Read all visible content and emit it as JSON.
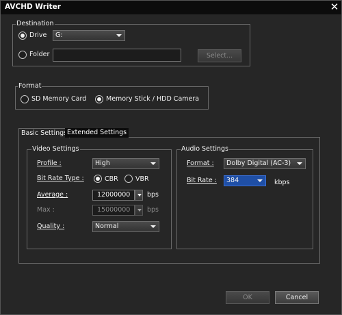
{
  "window": {
    "title": "AVCHD Writer",
    "close_glyph": "✕"
  },
  "destination": {
    "label": "Destination",
    "drive_label": "Drive",
    "drive_value": "G:",
    "folder_label": "Folder",
    "folder_value": "",
    "select_button": "Select..."
  },
  "format": {
    "label": "Format",
    "option_sd": "SD Memory Card",
    "option_ms": "Memory Stick / HDD Camera"
  },
  "tabs": {
    "basic": "Basic Settings",
    "extended": "Extended Settings"
  },
  "video": {
    "label": "Video Settings",
    "profile_label": "Profile :",
    "profile_value": "High",
    "bitrate_type_label": "Bit Rate Type :",
    "cbr": "CBR",
    "vbr": "VBR",
    "average_label": "Average :",
    "average_value": "12000000",
    "average_unit": "bps",
    "max_label": "Max :",
    "max_value": "15000000",
    "max_unit": "bps",
    "quality_label": "Quality :",
    "quality_value": "Normal"
  },
  "audio": {
    "label": "Audio Settings",
    "format_label": "Format :",
    "format_value": "Dolby Digital (AC-3)",
    "bitrate_label": "Bit Rate :",
    "bitrate_value": "384",
    "bitrate_unit": "kbps"
  },
  "buttons": {
    "ok": "OK",
    "cancel": "Cancel"
  },
  "colors": {
    "selected_combo": "#1f4fa6",
    "titlebar": "#0c0c0c",
    "background": "#262626"
  }
}
